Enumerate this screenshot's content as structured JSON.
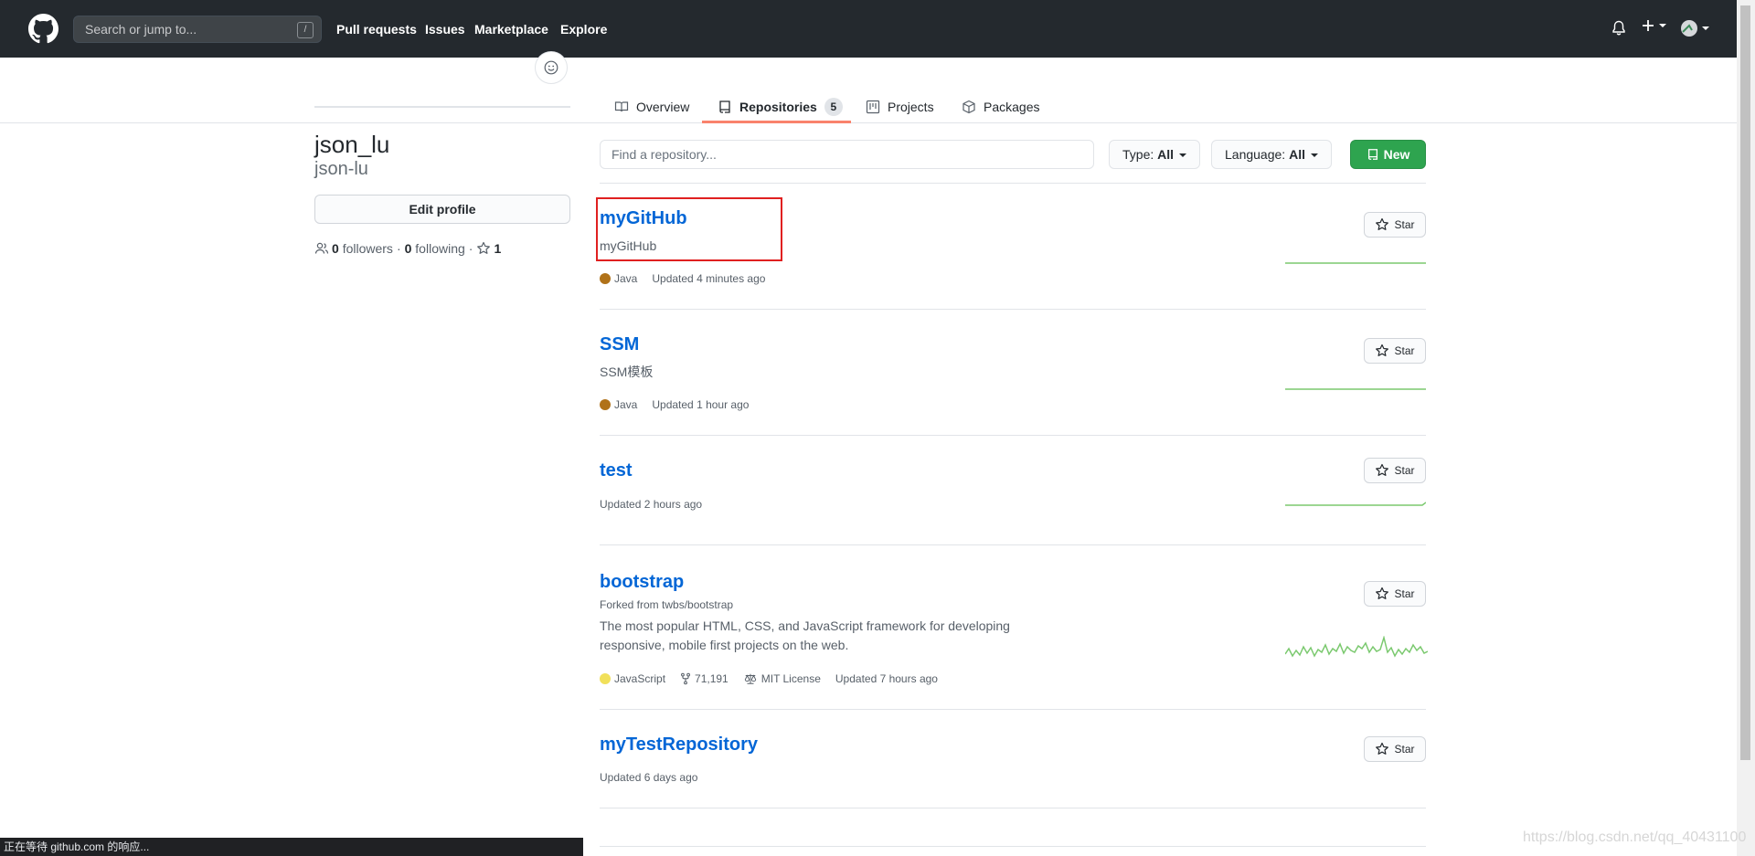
{
  "header": {
    "search_placeholder": "Search or jump to...",
    "search_shortcut": "/",
    "nav": [
      "Pull requests",
      "Issues",
      "Marketplace",
      "Explore"
    ]
  },
  "tabs": [
    {
      "label": "Overview"
    },
    {
      "label": "Repositories",
      "count": "5"
    },
    {
      "label": "Projects"
    },
    {
      "label": "Packages"
    }
  ],
  "profile": {
    "fullname": "json_lu",
    "username": "json-lu",
    "edit_label": "Edit profile",
    "followers_count": "0",
    "followers_label": "followers",
    "following_count": "0",
    "following_label": "following",
    "stars_count": "1",
    "sep": "·"
  },
  "filters": {
    "find_placeholder": "Find a repository...",
    "type_label": "Type:",
    "type_value": "All",
    "language_label": "Language:",
    "language_value": "All",
    "new_label": "New"
  },
  "star_label": "Star",
  "repos": [
    {
      "name": "myGitHub",
      "desc": "myGitHub",
      "lang": "Java",
      "lang_color": "#b07219",
      "updated": "Updated 4 minutes ago"
    },
    {
      "name": "SSM",
      "desc": "SSM模板",
      "lang": "Java",
      "lang_color": "#b07219",
      "updated": "Updated 1 hour ago"
    },
    {
      "name": "test",
      "updated": "Updated 2 hours ago"
    },
    {
      "name": "bootstrap",
      "fork": "Forked from twbs/bootstrap",
      "desc": "The most popular HTML, CSS, and JavaScript framework for developing responsive, mobile first projects on the web.",
      "lang": "JavaScript",
      "lang_color": "#f1e05a",
      "forks": "71,191",
      "license": "MIT License",
      "updated": "Updated 7 hours ago"
    },
    {
      "name": "myTestRepository",
      "updated": "Updated 6 days ago"
    }
  ],
  "status_bar": "正在等待 github.com 的响应...",
  "watermark": "https://blog.csdn.net/qq_40431100",
  "colors": {
    "header": "#24292e",
    "link": "#0366d6",
    "new_button": "#2ea44f",
    "tab_underline": "#f9826c",
    "highlight": "#e02020"
  }
}
